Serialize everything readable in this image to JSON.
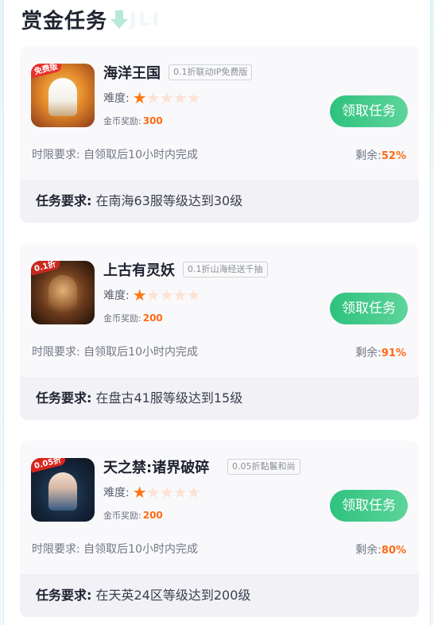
{
  "header": {
    "title": "赏金任务",
    "ghost_text": "JLI"
  },
  "labels": {
    "difficulty": "难度:",
    "reward": "金币奖励:",
    "remain": "剩余:",
    "requirement": "任务要求:",
    "claim": "领取任务"
  },
  "tasks": [
    {
      "name": "海洋王国",
      "tag": "0.1折联动IP免费版",
      "icon_badge": "免费版",
      "difficulty_stars": 1,
      "difficulty_max": 5,
      "reward": "300",
      "time_limit": "时限要求: 自领取后10小时内完成",
      "remain": "52%",
      "requirement": "在南海63服等级达到30级"
    },
    {
      "name": "上古有灵妖",
      "tag": "0.1折山海经送千抽",
      "icon_badge": "0.1折",
      "difficulty_stars": 1,
      "difficulty_max": 5,
      "reward": "200",
      "time_limit": "时限要求: 自领取后10小时内完成",
      "remain": "91%",
      "requirement": "在盘古41服等级达到15级"
    },
    {
      "name": "天之禁:诸界破碎",
      "tag": "0.05折黏鬟和尚",
      "icon_badge": "0.05折",
      "difficulty_stars": 1,
      "difficulty_max": 5,
      "reward": "200",
      "time_limit": "时限要求: 自领取后10小时内完成",
      "remain": "80%",
      "requirement": "在天英24区等级达到200级"
    }
  ],
  "colors": {
    "accent_green": "#2ec27e",
    "accent_orange": "#ff6a14",
    "star_on": "#ff7612",
    "star_off": "#fde2d3"
  }
}
